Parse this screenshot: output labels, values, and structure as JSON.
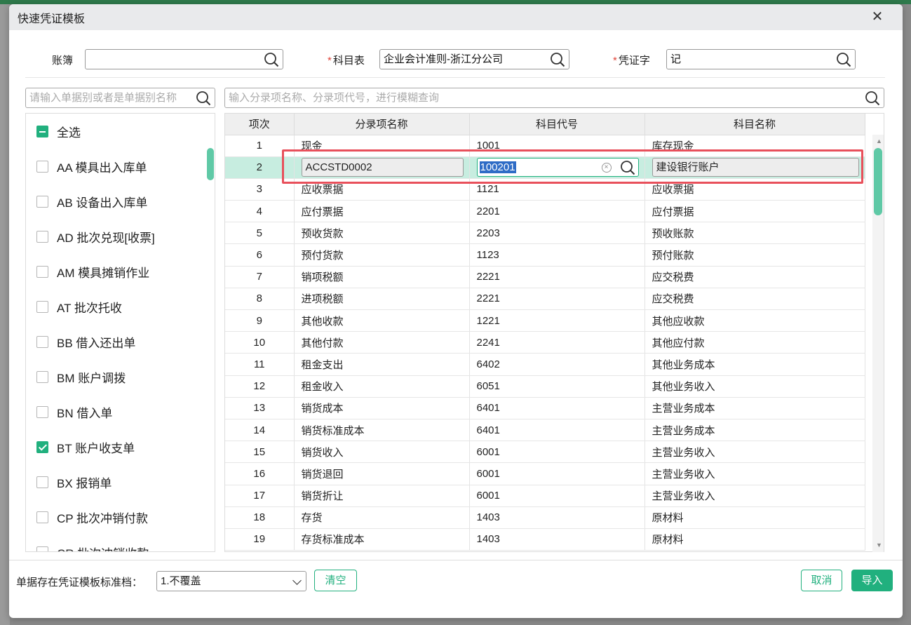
{
  "dialog": {
    "title": "快速凭证模板"
  },
  "fields": {
    "book": {
      "label": "账簿",
      "value": ""
    },
    "chart": {
      "label": "科目表",
      "value": "企业会计准则-浙江分公司",
      "required": "*"
    },
    "voucher": {
      "label": "凭证字",
      "value": "记",
      "required": "*"
    }
  },
  "filters": {
    "left_placeholder": "请输入单据别或者是单据别名称",
    "right_placeholder": "输入分录项名称、分录项代号，进行模糊查询"
  },
  "doc_types": [
    {
      "label": "全选",
      "state": "indeterminate"
    },
    {
      "label": "AA 模具出入库单",
      "state": "unchecked"
    },
    {
      "label": "AB 设备出入库单",
      "state": "unchecked"
    },
    {
      "label": "AD 批次兑现[收票]",
      "state": "unchecked"
    },
    {
      "label": "AM 模具摊销作业",
      "state": "unchecked"
    },
    {
      "label": "AT 批次托收",
      "state": "unchecked"
    },
    {
      "label": "BB 借入还出单",
      "state": "unchecked"
    },
    {
      "label": "BM 账户调拨",
      "state": "unchecked"
    },
    {
      "label": "BN 借入单",
      "state": "unchecked"
    },
    {
      "label": "BT 账户收支单",
      "state": "checked"
    },
    {
      "label": "BX 报销单",
      "state": "unchecked"
    },
    {
      "label": "CP 批次冲销付款",
      "state": "unchecked"
    },
    {
      "label": "CR 批次冲销收款",
      "state": "unchecked"
    }
  ],
  "table": {
    "headers": [
      "项次",
      "分录项名称",
      "科目代号",
      "科目名称"
    ],
    "rows": [
      [
        "1",
        "现金",
        "1001",
        "库存现金"
      ],
      [
        "2",
        "ACCSTD0002",
        "100201",
        "建设银行账户"
      ],
      [
        "3",
        "应收票据",
        "1121",
        "应收票据"
      ],
      [
        "4",
        "应付票据",
        "2201",
        "应付票据"
      ],
      [
        "5",
        "预收货款",
        "2203",
        "预收账款"
      ],
      [
        "6",
        "预付货款",
        "1123",
        "预付账款"
      ],
      [
        "7",
        "销项税额",
        "2221",
        "应交税费"
      ],
      [
        "8",
        "进项税额",
        "2221",
        "应交税费"
      ],
      [
        "9",
        "其他收款",
        "1221",
        "其他应收款"
      ],
      [
        "10",
        "其他付款",
        "2241",
        "其他应付款"
      ],
      [
        "11",
        "租金支出",
        "6402",
        "其他业务成本"
      ],
      [
        "12",
        "租金收入",
        "6051",
        "其他业务收入"
      ],
      [
        "13",
        "销货成本",
        "6401",
        "主营业务成本"
      ],
      [
        "14",
        "销货标准成本",
        "6401",
        "主营业务成本"
      ],
      [
        "15",
        "销货收入",
        "6001",
        "主营业务收入"
      ],
      [
        "16",
        "销货退回",
        "6001",
        "主营业务收入"
      ],
      [
        "17",
        "销货折让",
        "6001",
        "主营业务收入"
      ],
      [
        "18",
        "存货",
        "1403",
        "原材料"
      ],
      [
        "19",
        "存货标准成本",
        "1403",
        "原材料"
      ]
    ]
  },
  "footer": {
    "label": "单据存在凭证模板标准档：",
    "select_value": "1.不覆盖",
    "clear_label": "清空",
    "cancel_label": "取消",
    "import_label": "导入"
  },
  "colors": {
    "accent": "#21b07e",
    "highlight": "#e8505b",
    "active_row": "#c7ede0"
  }
}
